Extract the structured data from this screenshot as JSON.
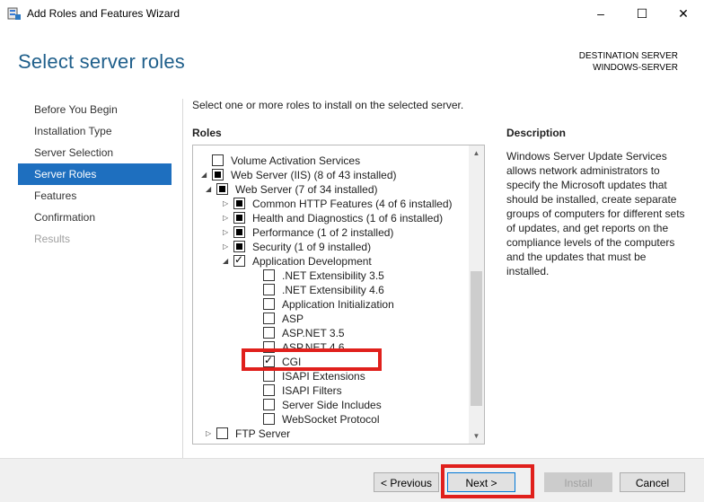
{
  "window": {
    "title": "Add Roles and Features Wizard",
    "minimize": "–",
    "maximize": "☐",
    "close": "✕"
  },
  "page_title": "Select server roles",
  "destination": {
    "label": "DESTINATION SERVER",
    "server": "WINDOWS-SERVER"
  },
  "nav": [
    {
      "label": "Before You Begin",
      "state": "normal"
    },
    {
      "label": "Installation Type",
      "state": "normal"
    },
    {
      "label": "Server Selection",
      "state": "normal"
    },
    {
      "label": "Server Roles",
      "state": "active"
    },
    {
      "label": "Features",
      "state": "normal"
    },
    {
      "label": "Confirmation",
      "state": "normal"
    },
    {
      "label": "Results",
      "state": "disabled"
    }
  ],
  "intro": "Select one or more roles to install on the selected server.",
  "roles_label": "Roles",
  "description_label": "Description",
  "description_text": "Windows Server Update Services allows network administrators to specify the Microsoft updates that should be installed, create separate groups of computers for different sets of updates, and get reports on the compliance levels of the computers and the updates that must be installed.",
  "roles": [
    {
      "label": "Volume Activation Services",
      "level": 0,
      "expander": "",
      "check": "unchecked"
    },
    {
      "label": "Web Server (IIS) (8 of 43 installed)",
      "level": 0,
      "expander": "open",
      "check": "partial"
    },
    {
      "label": "Web Server (7 of 34 installed)",
      "level": 1,
      "expander": "open",
      "check": "partial"
    },
    {
      "label": "Common HTTP Features (4 of 6 installed)",
      "level": 2,
      "expander": "closed",
      "check": "partial"
    },
    {
      "label": "Health and Diagnostics (1 of 6 installed)",
      "level": 2,
      "expander": "closed",
      "check": "partial"
    },
    {
      "label": "Performance (1 of 2 installed)",
      "level": 2,
      "expander": "closed",
      "check": "partial"
    },
    {
      "label": "Security (1 of 9 installed)",
      "level": 2,
      "expander": "closed",
      "check": "partial"
    },
    {
      "label": "Application Development",
      "level": 2,
      "expander": "open",
      "check": "checked"
    },
    {
      "label": ".NET Extensibility 3.5",
      "level": 3,
      "expander": "",
      "check": "unchecked"
    },
    {
      "label": ".NET Extensibility 4.6",
      "level": 3,
      "expander": "",
      "check": "unchecked"
    },
    {
      "label": "Application Initialization",
      "level": 3,
      "expander": "",
      "check": "unchecked"
    },
    {
      "label": "ASP",
      "level": 3,
      "expander": "",
      "check": "unchecked"
    },
    {
      "label": "ASP.NET 3.5",
      "level": 3,
      "expander": "",
      "check": "unchecked"
    },
    {
      "label": "ASP.NET 4.6",
      "level": 3,
      "expander": "",
      "check": "unchecked"
    },
    {
      "label": "CGI",
      "level": 3,
      "expander": "",
      "check": "checked"
    },
    {
      "label": "ISAPI Extensions",
      "level": 3,
      "expander": "",
      "check": "unchecked"
    },
    {
      "label": "ISAPI Filters",
      "level": 3,
      "expander": "",
      "check": "unchecked"
    },
    {
      "label": "Server Side Includes",
      "level": 3,
      "expander": "",
      "check": "unchecked"
    },
    {
      "label": "WebSocket Protocol",
      "level": 3,
      "expander": "",
      "check": "unchecked"
    },
    {
      "label": "FTP Server",
      "level": 1,
      "expander": "closed",
      "check": "unchecked"
    }
  ],
  "buttons": {
    "previous": "< Previous",
    "next": "Next >",
    "install": "Install",
    "cancel": "Cancel"
  },
  "colors": {
    "accent": "#1e6fbf",
    "title": "#1f5f8b",
    "highlight": "#e0201c"
  }
}
